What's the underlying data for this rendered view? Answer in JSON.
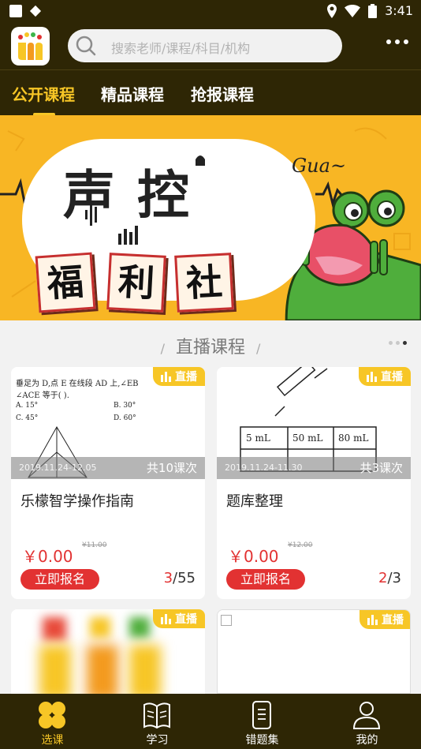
{
  "status_bar": {
    "time": "3:41"
  },
  "search": {
    "placeholder": "搜索老师/课程/科目/机构"
  },
  "tabs": [
    {
      "label": "公开课程",
      "active": true
    },
    {
      "label": "精品课程",
      "active": false
    },
    {
      "label": "抢报课程",
      "active": false
    }
  ],
  "banner": {
    "title": "声控",
    "subtitle_chars": [
      "福",
      "利",
      "社"
    ],
    "gua": "Gua~"
  },
  "section": {
    "title": "直播课程",
    "slash_left": "/",
    "slash_right": "/"
  },
  "courses": [
    {
      "badge": "直播",
      "date": "2019.11.24-12.05",
      "sessions": "共10课次",
      "name": "乐檬智学操作指南",
      "price": "￥0.00",
      "original_price": "¥11.00",
      "enroll": "立即报名",
      "enrolled": "3",
      "total": "/55",
      "thumb_text": {
        "line1": "垂足为 D,点 E 在线段 AD 上,∠EB",
        "line2": "∠ACE 等于(    ).",
        "optA": "A. 15°",
        "optB": "B. 30°",
        "optC": "C. 45°",
        "optD": "D. 60°"
      }
    },
    {
      "badge": "直播",
      "date": "2019.11.24-11.30",
      "sessions": "共3课次",
      "name": "题库整理",
      "price": "￥0.00",
      "original_price": "¥12.00",
      "enroll": "立即报名",
      "enrolled": "2",
      "total": "/3",
      "thumb_text": {
        "c1": "5 mL",
        "c2": "50 mL",
        "c3": "80 mL"
      }
    },
    {
      "badge": "直播"
    },
    {
      "badge": "直播"
    }
  ],
  "bottom_nav": [
    {
      "label": "选课",
      "icon": "clover-icon",
      "active": true
    },
    {
      "label": "学习",
      "icon": "book-icon",
      "active": false
    },
    {
      "label": "错题集",
      "icon": "phone-list-icon",
      "active": false
    },
    {
      "label": "我的",
      "icon": "user-icon",
      "active": false
    }
  ],
  "colors": {
    "dark": "#2e2605",
    "accent": "#f7c626",
    "red": "#e23232",
    "banner": "#f8b624"
  }
}
